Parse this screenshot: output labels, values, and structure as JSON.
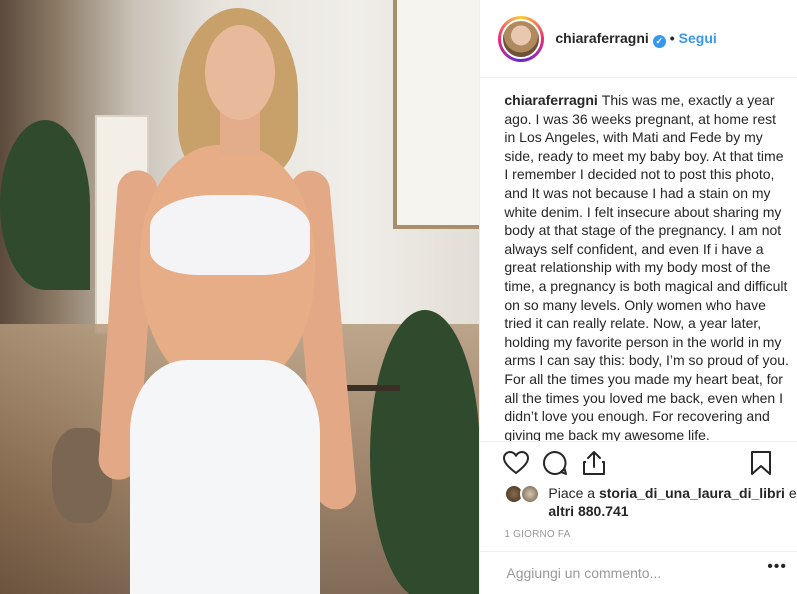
{
  "post": {
    "username": "chiaraferragni",
    "verified_icon": "verified-badge-icon",
    "separator": "•",
    "follow_label": "Segui",
    "caption": "This was me, exactly a year ago. I was 36 weeks pregnant, at home rest in Los Angeles, with Mati and Fede by my side, ready to meet my baby boy. At that time I remember I decided not to post this photo, and It was not because I had a stain on my white denim. I felt insecure about sharing my body at that stage of the pregnancy. I am not always self confident, and even If i have a great relationship with my body most of the time, a pregnancy is both magical and difficult on so many levels. Only women who have tried it can really relate. Now, a year later, holding my favorite person in the world in my arms I can say this: body, I’m so proud of you. For all the times you made my heart beat, for all the times you loved me back, even when I didn’t love you enough. For recovering and giving me back my awesome life.",
    "likes_prefix": "Piace a",
    "likes_user": "storia_di_una_laura_di_libri",
    "likes_and": "e",
    "likes_others": "altri 880.741",
    "timestamp": "1 GIORNO FA",
    "comment_placeholder": "Aggiungi un commento...",
    "more_label": "•••"
  },
  "icons": {
    "like": "heart-icon",
    "comment": "comment-bubble-icon",
    "share": "share-icon",
    "save": "bookmark-icon"
  },
  "colors": {
    "accent": "#3897f0",
    "text": "#262626",
    "muted": "#999999",
    "border": "#efefef"
  }
}
